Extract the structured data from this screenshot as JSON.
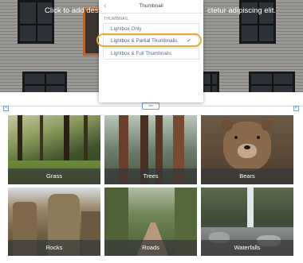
{
  "banner": {
    "text_left": "Click to add descript",
    "text_right": "ctetur adipiscing elit."
  },
  "panel": {
    "title": "Thumbnail",
    "section_label": "THUMBNAIL",
    "options": [
      {
        "label": "Lightbox Only",
        "selected": false
      },
      {
        "label": "Lightbox & Partial Thumbnails",
        "selected": true
      },
      {
        "label": "Lightbox & Full Thumbnails",
        "selected": false
      }
    ],
    "check_glyph": "✓",
    "back_glyph": "‹"
  },
  "frame": {
    "handle_glyph": "═",
    "corner_glyph": "✕"
  },
  "gallery": {
    "tiles": [
      {
        "caption": "Grass"
      },
      {
        "caption": "Trees"
      },
      {
        "caption": "Bears"
      },
      {
        "caption": "Rocks"
      },
      {
        "caption": "Roads"
      },
      {
        "caption": "Waterfalls"
      }
    ]
  },
  "colors": {
    "highlight": "#f0a83a",
    "accent": "#2f5fa5",
    "frame": "#6ea3e0"
  }
}
